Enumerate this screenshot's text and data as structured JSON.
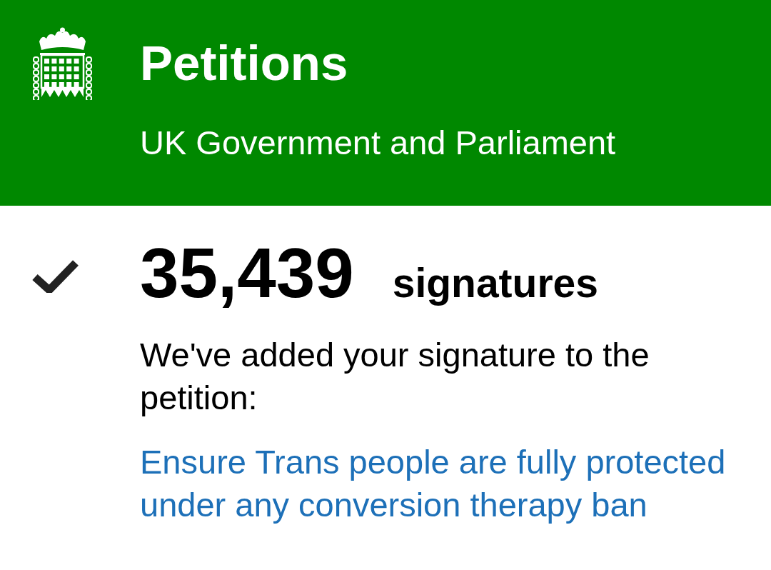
{
  "header": {
    "title": "Petitions",
    "subtitle": "UK Government and Parliament"
  },
  "signatures": {
    "count": "35,439",
    "label": "signatures"
  },
  "message": "We've added your signature to the petition:",
  "petition_link": "Ensure Trans people are fully protected under any conversion therapy ban"
}
